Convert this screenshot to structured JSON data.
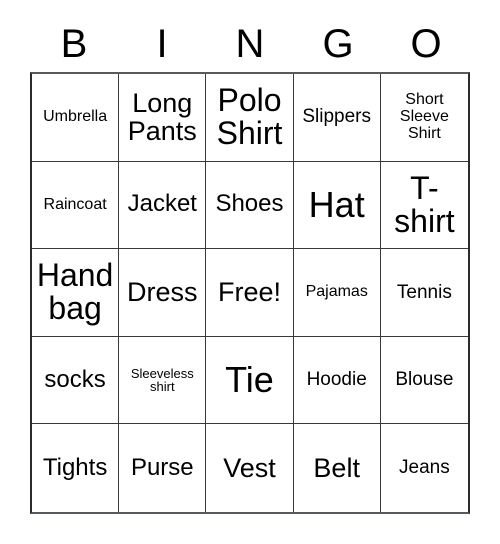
{
  "card": {
    "title": "BINGO",
    "headers": [
      "B",
      "I",
      "N",
      "G",
      "O"
    ],
    "free_space_label": "Free!",
    "colors": {
      "background": "#ffffff",
      "text": "#000000",
      "grid_line": "#3a3a3a",
      "outer_border": "#2b2b2b"
    },
    "grid": {
      "rows": 5,
      "columns": 5
    },
    "cells": [
      {
        "label": "Umbrella",
        "size": "s",
        "column": "B",
        "row": 1
      },
      {
        "label": "Long Pants",
        "size": "xl",
        "column": "I",
        "row": 1
      },
      {
        "label": "Polo Shirt",
        "size": "xxl",
        "column": "N",
        "row": 1
      },
      {
        "label": "Slippers",
        "size": "m",
        "column": "G",
        "row": 1
      },
      {
        "label": "Short Sleeve Shirt",
        "size": "s",
        "column": "O",
        "row": 1
      },
      {
        "label": "Raincoat",
        "size": "s",
        "column": "B",
        "row": 2
      },
      {
        "label": "Jacket",
        "size": "l",
        "column": "I",
        "row": 2
      },
      {
        "label": "Shoes",
        "size": "l",
        "column": "N",
        "row": 2
      },
      {
        "label": "Hat",
        "size": "max",
        "column": "G",
        "row": 2
      },
      {
        "label": "T-shirt",
        "size": "xxl",
        "column": "O",
        "row": 2
      },
      {
        "label": "Hand bag",
        "size": "xxl",
        "column": "B",
        "row": 3
      },
      {
        "label": "Dress",
        "size": "xl",
        "column": "I",
        "row": 3
      },
      {
        "label": "Free!",
        "size": "xl",
        "column": "N",
        "row": 3
      },
      {
        "label": "Pajamas",
        "size": "s",
        "column": "G",
        "row": 3
      },
      {
        "label": "Tennis",
        "size": "m",
        "column": "O",
        "row": 3
      },
      {
        "label": "socks",
        "size": "l",
        "column": "B",
        "row": 4
      },
      {
        "label": "Sleeveless shirt",
        "size": "xs",
        "column": "I",
        "row": 4
      },
      {
        "label": "Tie",
        "size": "max",
        "column": "N",
        "row": 4
      },
      {
        "label": "Hoodie",
        "size": "m",
        "column": "G",
        "row": 4
      },
      {
        "label": "Blouse",
        "size": "m",
        "column": "O",
        "row": 4
      },
      {
        "label": "Tights",
        "size": "l",
        "column": "B",
        "row": 5
      },
      {
        "label": "Purse",
        "size": "l",
        "column": "I",
        "row": 5
      },
      {
        "label": "Vest",
        "size": "xl",
        "column": "N",
        "row": 5
      },
      {
        "label": "Belt",
        "size": "xl",
        "column": "G",
        "row": 5
      },
      {
        "label": "Jeans",
        "size": "m",
        "column": "O",
        "row": 5
      }
    ]
  }
}
